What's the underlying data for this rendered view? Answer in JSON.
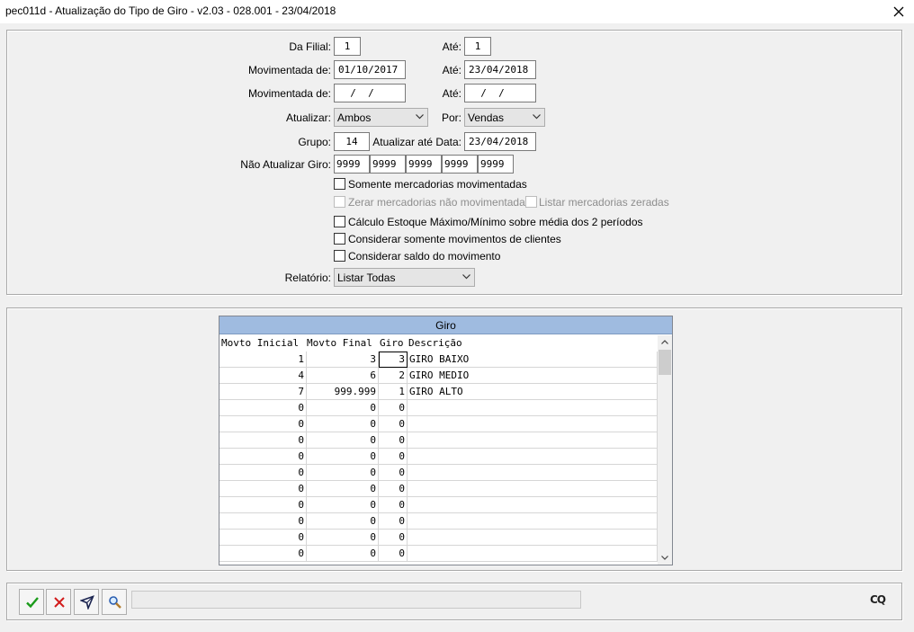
{
  "window": {
    "title": "pec011d - Atualização do Tipo de Giro - v2.03 - 028.001 - 23/04/2018",
    "close_icon": "close-icon"
  },
  "form": {
    "filial": {
      "label": "Da Filial:",
      "from": "1",
      "to_label": "Até:",
      "to": "1"
    },
    "mov1": {
      "label": "Movimentada de:",
      "from": "01/10/2017",
      "to_label": "Até:",
      "to": "23/04/2018"
    },
    "mov2": {
      "label": "Movimentada de:",
      "from": "  /  /",
      "to_label": "Até:",
      "to": "  /  /"
    },
    "atualizar": {
      "label": "Atualizar:",
      "value": "Ambos",
      "por_label": "Por:",
      "por_value": "Vendas"
    },
    "grupo": {
      "label": "Grupo:",
      "value": "14",
      "ate_data_label": "Atualizar até Data:",
      "ate_data": "23/04/2018"
    },
    "nao_atualizar": {
      "label": "Não Atualizar Giro:",
      "values": [
        "9999",
        "9999",
        "9999",
        "9999",
        "9999"
      ]
    },
    "checks": {
      "somente": "Somente mercadorias movimentadas",
      "zerar": "Zerar mercadorias não movimentadas",
      "listar_zeradas": "Listar mercadorias zeradas",
      "calculo": "Cálculo Estoque Máximo/Mínimo sobre média dos 2 períodos",
      "clientes": "Considerar somente movimentos de clientes",
      "saldo": "Considerar saldo do movimento"
    },
    "relatorio": {
      "label": "Relatório:",
      "value": "Listar Todas"
    }
  },
  "grid": {
    "title": "Giro",
    "columns": [
      "Movto Inicial",
      "Movto Final",
      "Giro",
      "Descrição"
    ],
    "rows": [
      [
        "1",
        "3",
        "3",
        "GIRO BAIXO"
      ],
      [
        "4",
        "6",
        "2",
        "GIRO MEDIO"
      ],
      [
        "7",
        "999.999",
        "1",
        "GIRO ALTO"
      ],
      [
        "0",
        "0",
        "0",
        ""
      ],
      [
        "0",
        "0",
        "0",
        ""
      ],
      [
        "0",
        "0",
        "0",
        ""
      ],
      [
        "0",
        "0",
        "0",
        ""
      ],
      [
        "0",
        "0",
        "0",
        ""
      ],
      [
        "0",
        "0",
        "0",
        ""
      ],
      [
        "0",
        "0",
        "0",
        ""
      ],
      [
        "0",
        "0",
        "0",
        ""
      ],
      [
        "0",
        "0",
        "0",
        ""
      ],
      [
        "0",
        "0",
        "0",
        ""
      ]
    ]
  },
  "toolbar": {
    "buttons": [
      "confirm-icon",
      "cancel-icon",
      "filter-icon",
      "search-icon"
    ],
    "status": "",
    "logo": "CQ"
  },
  "colors": {
    "grid_header": "#9fbbe0",
    "confirm": "#1a9b1a",
    "cancel": "#d21b1b"
  }
}
